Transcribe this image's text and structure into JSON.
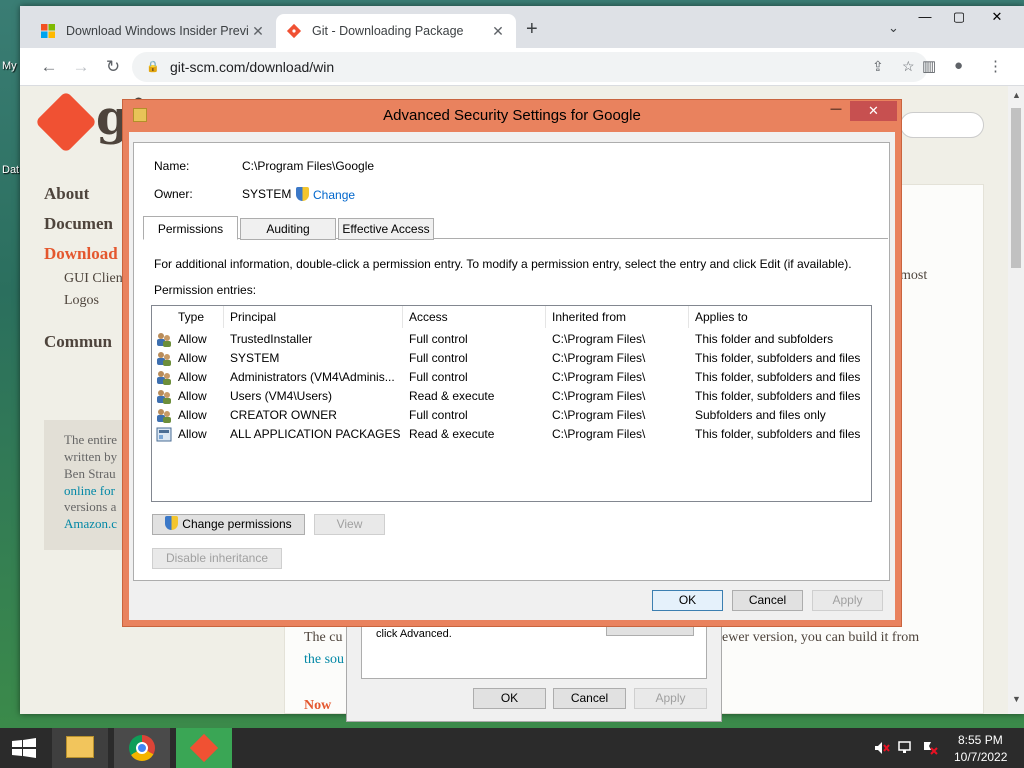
{
  "desktop": {
    "labels": [
      "My",
      "Dat"
    ]
  },
  "browser": {
    "tabs": [
      {
        "title": "Download Windows Insider Previ",
        "close": "✕"
      },
      {
        "title": "Git - Downloading Package",
        "close": "✕"
      }
    ],
    "new_tab": "+",
    "tab_search": "⌄",
    "window_controls": {
      "minimize": "—",
      "maximize": "▢",
      "close": "✕"
    },
    "toolbar": {
      "back": "←",
      "forward": "→",
      "reload": "↻",
      "lock": "🔒",
      "url": "git-scm.com/download/win",
      "share": "⇪",
      "bookmark": "☆",
      "sidepanel": "▥",
      "profile": "●",
      "menu": "⋮"
    },
    "page": {
      "logo_text": "gi",
      "sidebar": [
        {
          "label": "About"
        },
        {
          "label": "Documen"
        },
        {
          "label": "Download"
        },
        {
          "label": "Commun"
        }
      ],
      "sidebar_sub": [
        "GUI Clien",
        "Logos"
      ],
      "book_lines": [
        "The entire",
        "written by",
        "Ben Strau",
        "online for",
        "versions a",
        "Amazon.c"
      ],
      "main_lines": {
        "right_fragment": "most",
        "line1_a": "The cu",
        "line1_b": "ewer version, you can build it from",
        "line2": "the sou",
        "heading_fragment": "Now"
      },
      "scroll": {
        "up": "▲",
        "down": "▼"
      }
    }
  },
  "bg_dialog": {
    "text": "click Advanced.",
    "ok": "OK",
    "cancel": "Cancel",
    "apply": "Apply"
  },
  "dialog": {
    "title": "Advanced Security Settings for Google",
    "controls": {
      "minimize": "—",
      "maximize": "▢",
      "close": "✕"
    },
    "name_label": "Name:",
    "name_value": "C:\\Program Files\\Google",
    "owner_label": "Owner:",
    "owner_value": "SYSTEM",
    "owner_change": "Change",
    "tabs": [
      "Permissions",
      "Auditing",
      "Effective Access"
    ],
    "info": "For additional information, double-click a permission entry. To modify a permission entry, select the entry and click Edit (if available).",
    "entries_label": "Permission entries:",
    "columns": [
      "Type",
      "Principal",
      "Access",
      "Inherited from",
      "Applies to"
    ],
    "rows": [
      {
        "type": "Allow",
        "principal": "TrustedInstaller",
        "access": "Full control",
        "inherited": "C:\\Program Files\\",
        "applies": "This folder and subfolders",
        "icon": "users-icon"
      },
      {
        "type": "Allow",
        "principal": "SYSTEM",
        "access": "Full control",
        "inherited": "C:\\Program Files\\",
        "applies": "This folder, subfolders and files",
        "icon": "users-icon"
      },
      {
        "type": "Allow",
        "principal": "Administrators (VM4\\Adminis...",
        "access": "Full control",
        "inherited": "C:\\Program Files\\",
        "applies": "This folder, subfolders and files",
        "icon": "users-icon"
      },
      {
        "type": "Allow",
        "principal": "Users (VM4\\Users)",
        "access": "Read & execute",
        "inherited": "C:\\Program Files\\",
        "applies": "This folder, subfolders and files",
        "icon": "users-icon"
      },
      {
        "type": "Allow",
        "principal": "CREATOR OWNER",
        "access": "Full control",
        "inherited": "C:\\Program Files\\",
        "applies": "Subfolders and files only",
        "icon": "users-icon"
      },
      {
        "type": "Allow",
        "principal": "ALL APPLICATION PACKAGES",
        "access": "Read & execute",
        "inherited": "C:\\Program Files\\",
        "applies": "This folder, subfolders and files",
        "icon": "app-packages-icon"
      }
    ],
    "change_permissions": "Change permissions",
    "view": "View",
    "disable_inheritance": "Disable inheritance",
    "ok": "OK",
    "cancel": "Cancel",
    "apply": "Apply"
  },
  "taskbar": {
    "time": "8:55 PM",
    "date": "10/7/2022"
  },
  "colors": {
    "accent": "#e9825e",
    "git_orange": "#f05133",
    "taskbar": "#2b2b2b"
  }
}
